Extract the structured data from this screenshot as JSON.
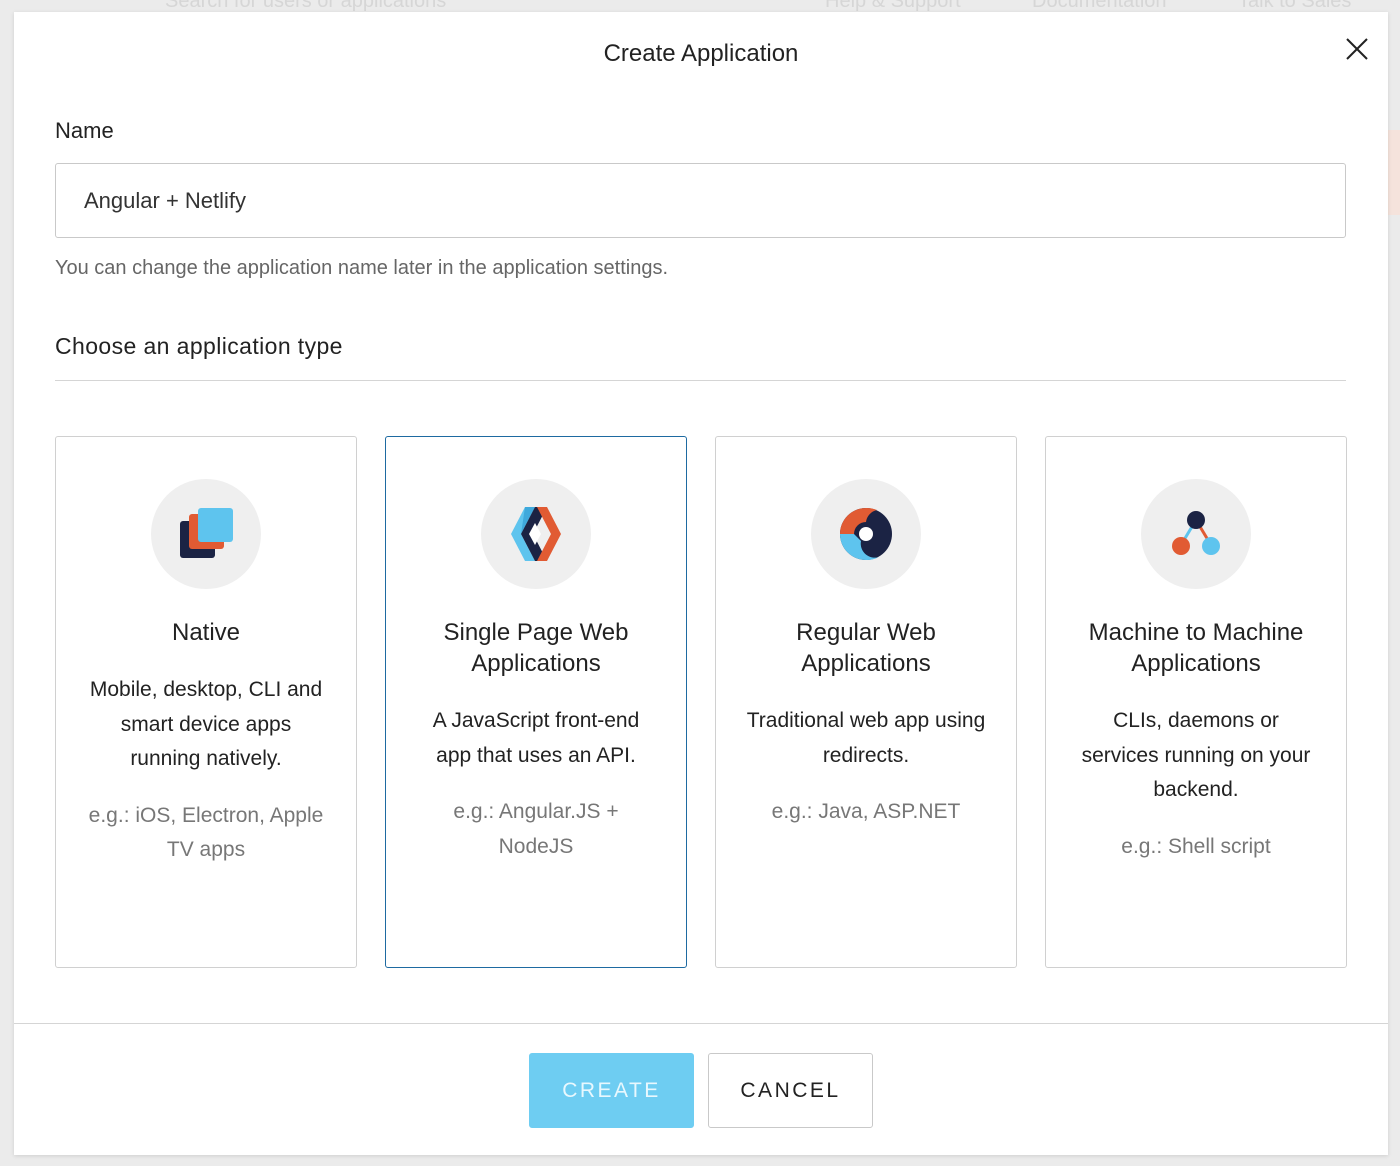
{
  "background": {
    "search_placeholder": "Search for users or applications",
    "links": [
      "Help & Support",
      "Documentation",
      "Talk to Sales"
    ]
  },
  "dialog": {
    "title": "Create Application",
    "close_icon": "close-icon"
  },
  "name_field": {
    "label": "Name",
    "value": "Angular + Netlify",
    "help": "You can change the application name later in the application settings."
  },
  "app_type": {
    "heading": "Choose an application type",
    "selected_index": 1,
    "cards": [
      {
        "title": "Native",
        "description": "Mobile, desktop, CLI and smart device apps running natively.",
        "example": "e.g.: iOS, Electron, Apple TV apps",
        "icon": "native-stacked-squares-icon"
      },
      {
        "title": "Single Page Web Applications",
        "description": "A JavaScript front-end app that uses an API.",
        "example": "e.g.: Angular.JS + NodeJS",
        "icon": "spa-diamond-icon"
      },
      {
        "title": "Regular Web Applications",
        "description": "Traditional web app using redirects.",
        "example": "e.g.: Java, ASP.NET",
        "icon": "regular-web-circle-icon"
      },
      {
        "title": "Machine to Machine Applications",
        "description": "CLIs, daemons or services running on your backend.",
        "example": "e.g.: Shell script",
        "icon": "machine-nodes-icon"
      }
    ]
  },
  "actions": {
    "create_label": "CREATE",
    "cancel_label": "CANCEL"
  },
  "colors": {
    "navy": "#1b2344",
    "orange": "#e15b33",
    "sky": "#5ec4ee",
    "selected_border": "#1e6aa1",
    "create_button": "#6ecdf2"
  }
}
